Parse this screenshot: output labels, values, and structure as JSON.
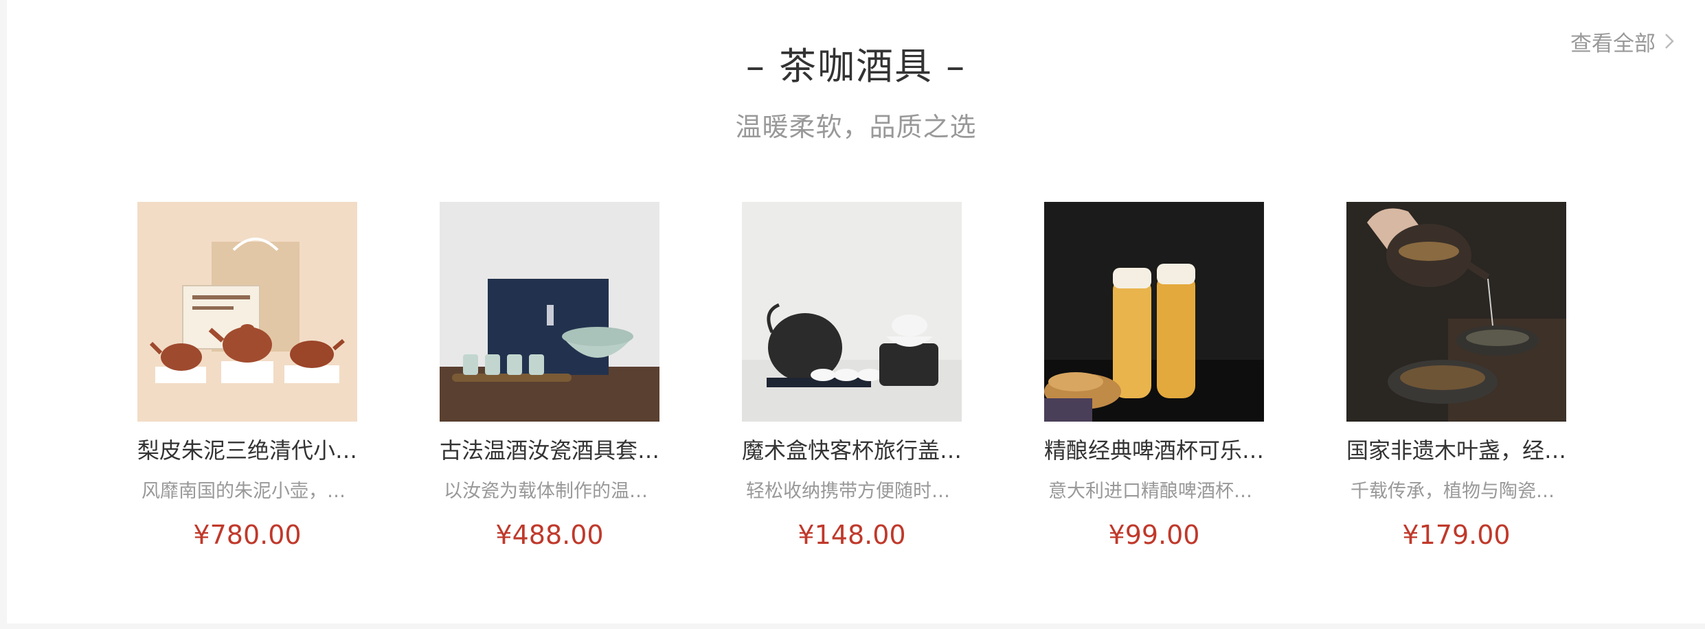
{
  "section": {
    "title": "– 茶咖酒具 –",
    "subtitle": "温暖柔软，品质之选",
    "view_all_label": "查看全部",
    "accent_color": "#c0392b"
  },
  "products": [
    {
      "name": "梨皮朱泥三绝清代小…",
      "desc": "风靡南国的朱泥小壶，…",
      "price": "¥780.00",
      "image_icon": "teapot-set-image"
    },
    {
      "name": "古法温酒汝瓷酒具套…",
      "desc": "以汝瓷为载体制作的温…",
      "price": "¥488.00",
      "image_icon": "ru-porcelain-wine-set-image"
    },
    {
      "name": "魔术盒快客杯旅行盖…",
      "desc": "轻松收纳携带方便随时…",
      "price": "¥148.00",
      "image_icon": "travel-tea-set-image"
    },
    {
      "name": "精酿经典啤酒杯可乐…",
      "desc": "意大利进口精酿啤酒杯…",
      "price": "¥99.00",
      "image_icon": "beer-glass-image"
    },
    {
      "name": "国家非遗木叶盏，经…",
      "desc": "千载传承，植物与陶瓷…",
      "price": "¥179.00",
      "image_icon": "leaf-tea-bowl-image"
    }
  ]
}
